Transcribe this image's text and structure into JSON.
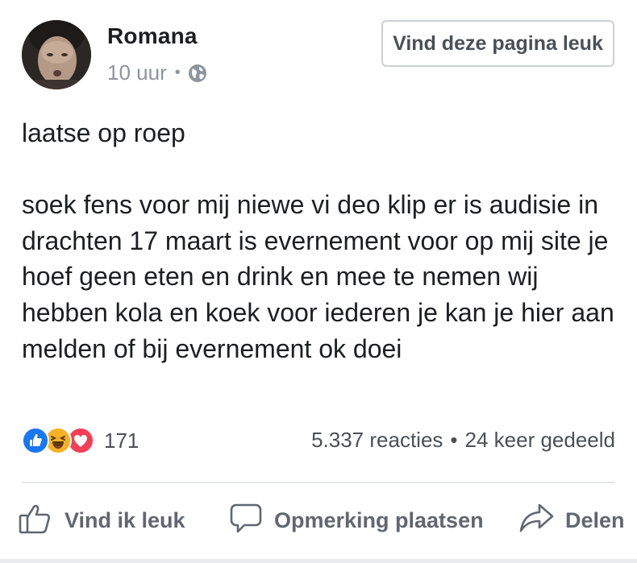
{
  "post": {
    "author": "Romana",
    "time": "10 uur",
    "separator": "•",
    "audience_icon": "globe-icon",
    "like_page_button": "Vind deze pagina leuk",
    "text_lines": {
      "first": "laatse op roep",
      "second": "soek fens voor mij niewe vi deo klip  er is audisie in drachten 17 maart is evernement voor op mij site je hoef geen eten en drink en mee te nemen wij hebben kola en koek voor iederen je kan je hier aan melden of bij evernement ok doei"
    }
  },
  "engagement": {
    "reaction_icons": [
      "like-reaction-icon",
      "haha-reaction-icon",
      "love-reaction-icon"
    ],
    "reaction_count": "171",
    "comments": "5.337 reacties",
    "stats_separator": "•",
    "shares": "24 keer gedeeld"
  },
  "actions": {
    "like": "Vind ik leuk",
    "comment": "Opmerking plaatsen",
    "share": "Delen"
  },
  "colors": {
    "like_blue": "#1877f2",
    "haha_yellow": "#f7b125",
    "love_red": "#f33e58",
    "secondary_text": "#8d949e",
    "action_text": "#606770"
  }
}
